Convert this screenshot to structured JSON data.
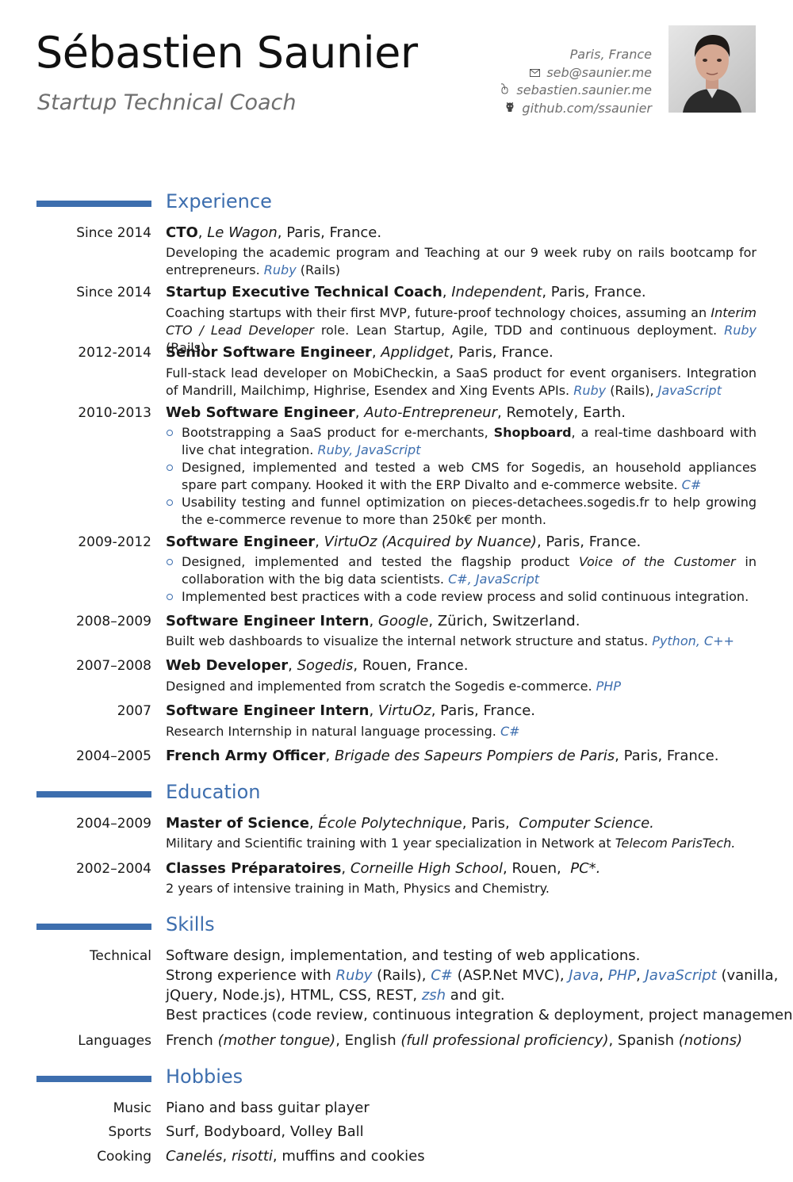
{
  "header": {
    "name": "Sébastien Saunier",
    "title": "Startup Technical Coach",
    "location": "Paris, France",
    "email": "seb@saunier.me",
    "website": "sebastien.saunier.me",
    "github": "github.com/ssaunier"
  },
  "sections": {
    "experience": "Experience",
    "education": "Education",
    "skills": "Skills",
    "hobbies": "Hobbies"
  },
  "experience": [
    {
      "date": "Since 2014",
      "role": "CTO",
      "company": "Le Wagon",
      "location": "Paris, France.",
      "desc": "Developing the academic program and Teaching at our 9 week ruby on rails bootcamp for entrepreneurs.",
      "tech_kw": "Ruby",
      "tech_rest": " (Rails)"
    },
    {
      "date": "Since 2014",
      "role": "Startup Executive Technical Coach",
      "company": "Independent",
      "location": "Paris, France."
    },
    {
      "date": "2012-2014",
      "role": "Senior Software Engineer",
      "company": "Applidget",
      "location": "Paris, France."
    },
    {
      "date": "2010-2013",
      "role": "Web Software Engineer",
      "company": "Auto-Entrepreneur",
      "location": "Remotely, Earth."
    },
    {
      "date": "2009-2012",
      "role": "Software Engineer",
      "company": "VirtuOz (Acquired by Nuance)",
      "location": "Paris, France."
    },
    {
      "date": "2008–2009",
      "role": "Software Engineer Intern",
      "company": "Google",
      "location": "Zürich, Switzerland.",
      "desc": "Built web dashboards to visualize the internal network structure and status.",
      "tech": "Python, C++"
    },
    {
      "date": "2007–2008",
      "role": "Web Developer",
      "company": "Sogedis",
      "location": "Rouen, France.",
      "desc": "Designed and implemented from scratch the Sogedis e-commerce.",
      "tech": "PHP"
    },
    {
      "date": "2007",
      "role": "Software Engineer Intern",
      "company": "VirtuOz",
      "location": "Paris, France.",
      "desc": "Research Internship in natural language processing.",
      "tech": "C#"
    },
    {
      "date": "2004–2005",
      "role": "French Army Officer",
      "company": "Brigade des Sapeurs Pompiers de Paris",
      "location": "Paris, France."
    }
  ],
  "exp_coach": {
    "desc_a": "Coaching startups with their first MVP, future-proof technology choices, assuming an ",
    "desc_em": "Interim CTO / Lead Developer",
    "desc_b": " role. Lean Startup, Agile, TDD and continuous deployment.",
    "tech_kw": "Ruby",
    "tech_rest": " (Rails)"
  },
  "exp_applidget": {
    "desc": "Full-stack lead developer on MobiCheckin, a SaaS product for event organisers. Integration of Mandrill, Mailchimp, Highrise, Esendex and Xing Events APIs.",
    "tech1": "Ruby",
    "tech1_rest": " (Rails),",
    "tech2": "JavaScript"
  },
  "exp_freelance": {
    "item1_a": "Bootstrapping a SaaS product for e-merchants, ",
    "item1_b": "Shopboard",
    "item1_c": ", a real-time dashboard with live chat integration.",
    "item1_tech": "Ruby, JavaScript",
    "item2": "Designed, implemented and tested a web CMS for Sogedis, an household appliances spare part company. Hooked it with the ERP Divalto and e-commerce website.",
    "item2_tech": "C#",
    "item3": "Usability testing and funnel optimization on pieces-detachees.sogedis.fr to help growing the e-commerce revenue to more than 250k€ per month."
  },
  "exp_virtuoz": {
    "item1_a": "Designed, implemented and tested the flagship product ",
    "item1_em": "Voice of the Customer",
    "item1_b": " in collaboration with the big data scientists.",
    "item1_tech": "C#, JavaScript",
    "item2": "Implemented best practices with a code review process and solid continuous integration."
  },
  "education": [
    {
      "date": "2004–2009",
      "degree": "Master of Science",
      "school": "École Polytechnique",
      "location": "Paris,",
      "field": "Computer Science."
    },
    {
      "date": "2002–2004",
      "degree": "Classes Préparatoires",
      "school": "Corneille High School",
      "location": "Rouen,",
      "field": "PC*."
    }
  ],
  "edu_master": {
    "desc_a": "Military and Scientific training with 1 year specialization in Network at ",
    "desc_em": "Telecom ParisTech."
  },
  "edu_prepa": {
    "desc": "2 years of intensive training in Math, Physics and Chemistry."
  },
  "skills": {
    "technical_label": "Technical",
    "line1": "Software design, implementation, and testing of web applications.",
    "line2_a": "Strong experience with ",
    "ruby": "Ruby",
    "rails": " (Rails), ",
    "csharp": "C#",
    "aspnet": " (ASP.Net MVC), ",
    "java": "Java",
    "comma1": ", ",
    "php": "PHP",
    "comma2": ", ",
    "javascript": "JavaScript",
    "vanilla": " (vanilla,",
    "line3_a": "jQuery, Node.js), HTML, CSS, REST, ",
    "zsh": "zsh",
    "line3_b": " and git.",
    "line4": "Best practices (code review, continuous integration & deployment, project management).",
    "languages_label": "Languages",
    "lang_french": "French ",
    "lang_french_note": "(mother tongue)",
    "lang_english": ", English ",
    "lang_english_note": "(full professional proficiency)",
    "lang_spanish": ", Spanish ",
    "lang_spanish_note": "(notions)"
  },
  "hobbies": [
    {
      "label": "Music",
      "value": "Piano and bass guitar player"
    },
    {
      "label": "Sports",
      "value": "Surf, Bodyboard, Volley Ball"
    },
    {
      "label": "Cooking",
      "value_em1": "Canelés",
      "value_sep": ", ",
      "value_em2": "risotti",
      "value_rest": ", muffins and cookies"
    }
  ],
  "icons": [
    "envelope-icon",
    "mouse-icon",
    "github-octocat-icon"
  ],
  "colors": {
    "accent": "#3d6eae",
    "subtitle": "#6f6f6f",
    "text": "#1a1a1a"
  }
}
